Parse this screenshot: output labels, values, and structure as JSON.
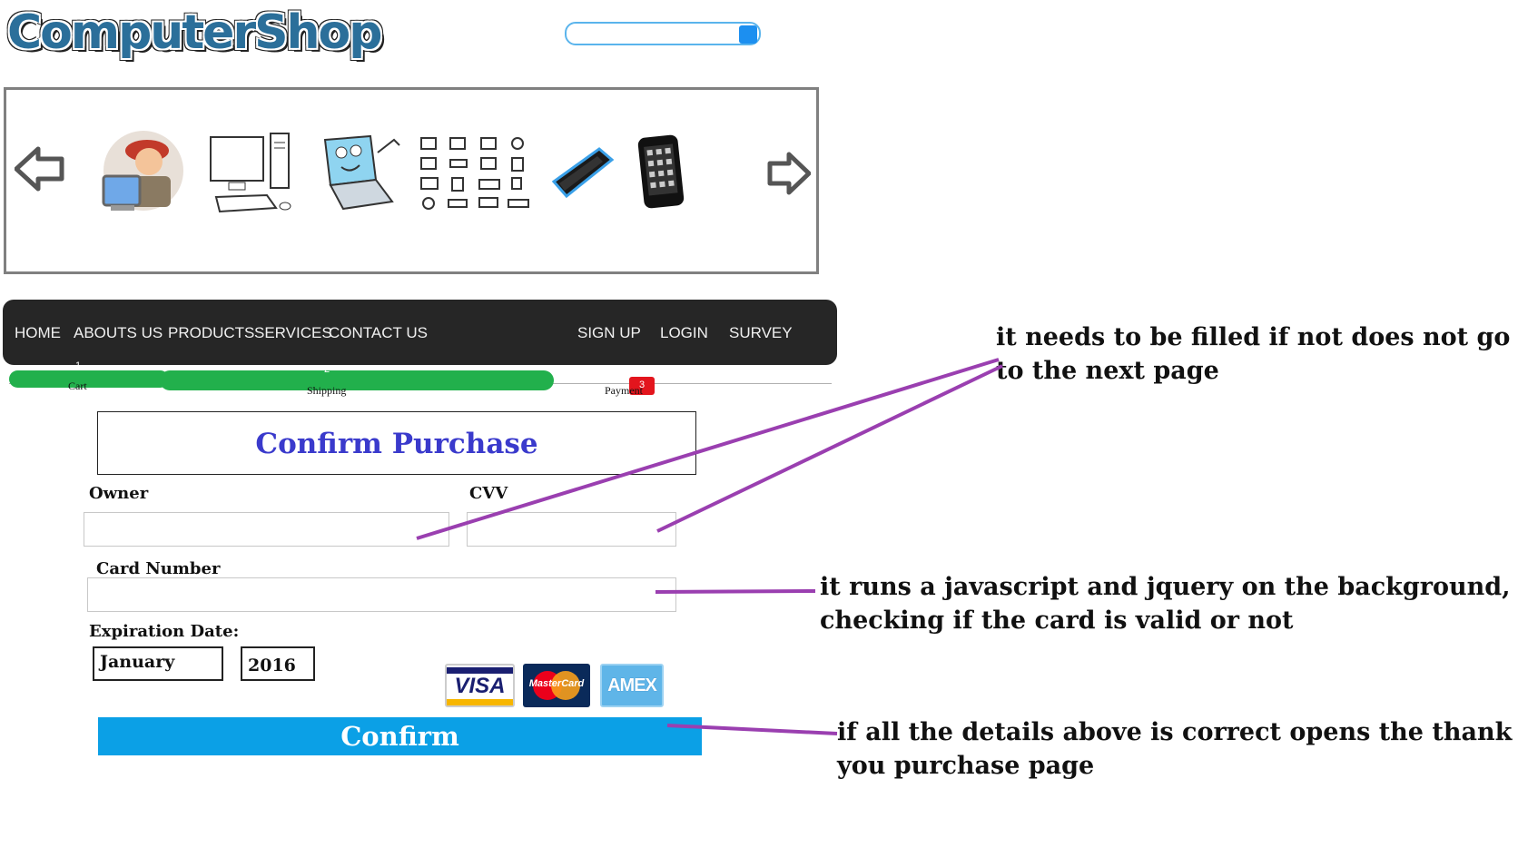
{
  "header": {
    "logo_text": "ComputerShop"
  },
  "carousel": {
    "left_arrow_icon": "arrow-left-outline-icon",
    "right_arrow_icon": "arrow-right-outline-icon",
    "items": [
      {
        "icon": "technician-with-computer"
      },
      {
        "icon": "desktop-computer"
      },
      {
        "icon": "cartoon-laptop"
      },
      {
        "icon": "computer-parts-grid"
      },
      {
        "icon": "black-blue-phone"
      },
      {
        "icon": "smartphone"
      }
    ]
  },
  "nav": {
    "left_items": [
      "HOME",
      "ABOUTS US",
      "PRODUCTS",
      "SERVICES",
      "CONTACT US"
    ],
    "right_items": [
      "SIGN UP",
      "LOGIN",
      "SURVEY"
    ]
  },
  "steps": [
    {
      "number": "1",
      "label": "Cart",
      "color": "#22b04c"
    },
    {
      "number": "2",
      "label": "Shipping",
      "color": "#22b04c"
    },
    {
      "number": "3",
      "label": "Payment",
      "color": "#e3151d"
    }
  ],
  "form": {
    "title": "Confirm Purchase",
    "owner_label": "Owner",
    "owner_value": "",
    "cvv_label": "CVV",
    "cvv_value": "",
    "card_number_label": "Card Number",
    "card_number_value": "",
    "expiration_label": "Expiration Date:",
    "month_selected": "January",
    "year_selected": "2016",
    "cards": [
      "VISA",
      "MasterCard",
      "AMEX"
    ],
    "confirm_label": "Confirm"
  },
  "annotations": {
    "note1_line1": "it needs to be filled if not does not go",
    "note1_line2": "to the next page",
    "note2_line1": "it runs a javascript and jquery on the background,",
    "note2_line2": "checking if the card is valid or not",
    "note3_line1": "if all the details above is correct opens the thank",
    "note3_line2": "you purchase page",
    "line_color": "#9a3fb0"
  }
}
